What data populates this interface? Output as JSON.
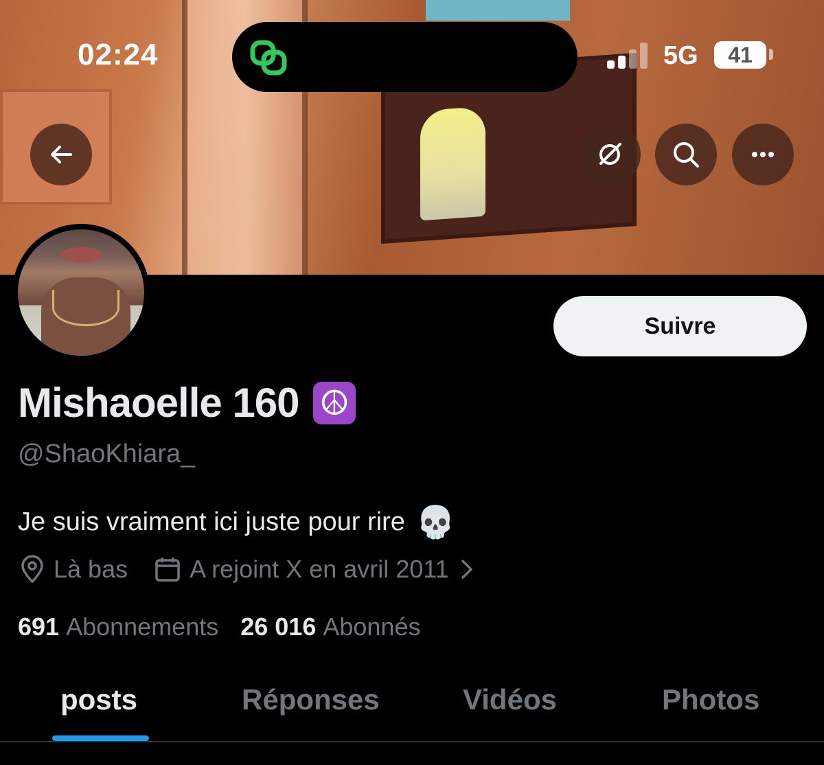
{
  "status_bar": {
    "time": "02:24",
    "network": "5G",
    "battery": "41"
  },
  "profile": {
    "display_name": "Mishaoelle 160",
    "name_emoji": "☮",
    "handle": "@ShaoKhiara_",
    "bio": "Je suis vraiment ici juste pour rire",
    "bio_emoji": "💀",
    "location": "Là bas",
    "joined": "A rejoint X en avril 2011",
    "following_count": "691",
    "following_label": "Abonnements",
    "followers_count": "26 016",
    "followers_label": "Abonnés",
    "follow_button": "Suivre"
  },
  "tabs": [
    {
      "label": "posts",
      "active": true
    },
    {
      "label": "Réponses",
      "active": false
    },
    {
      "label": "Vidéos",
      "active": false
    },
    {
      "label": "Photos",
      "active": false
    }
  ],
  "icons": {
    "back": "arrow-left-icon",
    "grok": "grok-icon",
    "search": "search-icon",
    "more": "more-icon",
    "location": "location-pin-icon",
    "calendar": "calendar-icon",
    "chevron": "chevron-right-icon",
    "island_app": "link-icon"
  },
  "colors": {
    "accent": "#1d9bf0",
    "background": "#000000",
    "muted": "#71767b",
    "island_icon": "#34c759"
  }
}
